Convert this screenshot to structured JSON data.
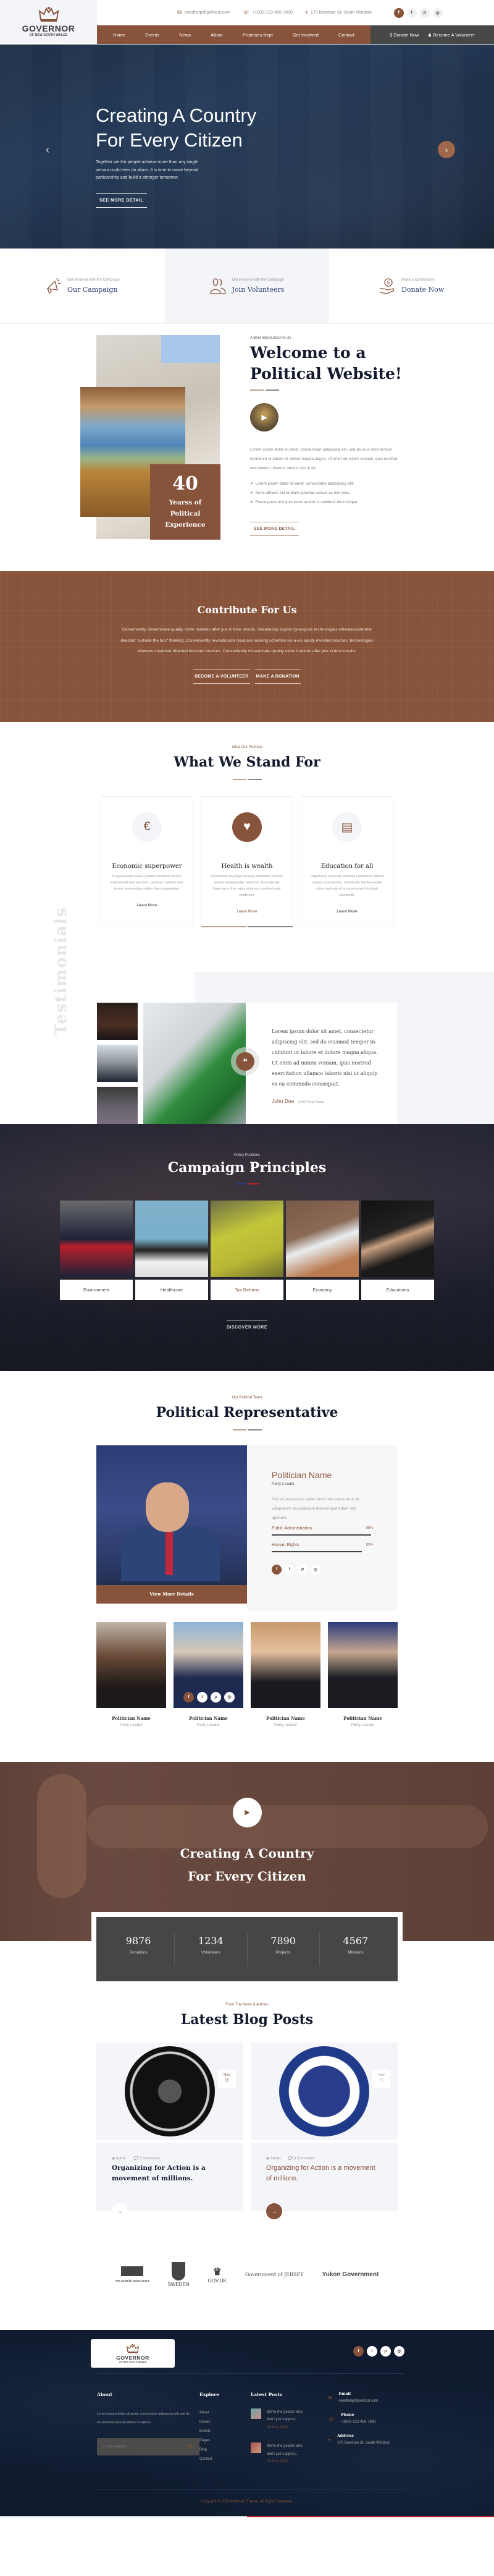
{
  "brand": {
    "title": "GOVERNOR",
    "subtitle": "OF NEW SOUTH WALES"
  },
  "topbar": {
    "email": "needhelp@political.com",
    "phone": "+1800-123-456-7890",
    "address": "170 Bowman St. South Windsor.",
    "socials": [
      "f",
      "t",
      "p",
      "i"
    ]
  },
  "nav": {
    "items": [
      "Home",
      "Events",
      "News",
      "About",
      "Promises Kept",
      "Get Involved",
      "Contact"
    ],
    "donate": "Donate Now",
    "volunteer": "Become A Volunteer"
  },
  "hero": {
    "title_line1": "Creating A Country",
    "title_line2": "For Every Citizen",
    "text": "Together we the people achieve more than any single person could ever do alone. It is time to move beyond partisanship and build a stronger tomorrow.",
    "button": "SEE MORE DETAIL"
  },
  "features": [
    {
      "small": "Get involved with the Campaign",
      "title": "Our Campaign",
      "icon": "megaphone-icon"
    },
    {
      "small": "Get involved with the Campaign",
      "title": "Join Volunteers",
      "icon": "people-icon"
    },
    {
      "small": "Make a Contribution",
      "title": "Donate Now",
      "icon": "donate-hand-icon"
    }
  ],
  "about": {
    "kicker": "A Brief Introduction to Us",
    "title_line1": "Welcome to a",
    "title_line2": "Political Website!",
    "text": "Lorem ipsum dolor sit amet, consectetur adipiscing elit, sed do eius-mod tempor incididunt ut labore et dolore magna aliqua. Ut enim ad minim veniam, quis nostrud exercitation ullamco laboris nisi ut ali-",
    "checks": [
      "Lorem ipsum dolor sit amet, consectetur adipisicing elit.",
      "Nunc ultrices est at diam pulvinar cursus ac non eros.",
      "Fusce porta orci quis lacus auctor, in eleifend dui tristique."
    ],
    "button": "SEE MORE DETAIL",
    "badge_number": "40",
    "badge_line1": "Yearss of",
    "badge_line2": "Political",
    "badge_line3": "Experience"
  },
  "contribute": {
    "title": "Contribute For Us",
    "text": "Conveniently disseminate quality niche markets after just in time results. Seamlessly exploit synergistic technologies whereascustomer directed \"outside the box\" thinking. Conveniently revolutionize resource sucking schemas vis-a-vis equity invested sources. technologies whereas customer directed  invested sources. Conveniently disseminate quality niche markets after just in time results.",
    "btn_volunteer": "BECOME A VOLUNTEER",
    "btn_donate": "MAKE A DONATION"
  },
  "stand": {
    "kicker": "What Our Promise",
    "title": "What We Stand For",
    "cards": [
      {
        "title": "Economic superpower",
        "text": "Progressively evolve parallel interfaces before empowered web services. Quick-ly cultivate one-to-one partnerships rather than cooperative.",
        "link": "Learn More",
        "icon": "€"
      },
      {
        "title": "Health is wealth",
        "text": "Seamlessly leverage existing worldwide sources before leading-edge networks. Dramatically foster error-free value whereas covalent web-readiness.",
        "link": "Learn More",
        "icon": "♥"
      },
      {
        "title": "Education for all",
        "text": "Objectively evacuate seamless platforms without unique communities. Holistically fashion world-class methods of empow-erment for high standards.",
        "link": "Learn More",
        "icon": "📚"
      }
    ]
  },
  "testimonials": {
    "vertical_label": "Testimonials",
    "quote": "Lorem ipsum dolor sit amet, consectetur adipiscing elit, sed do eiusmod tempor in-cididunt ut labore et dolore magna aliqua. Ut enim ad minim veniam, quis nostrud exercitation ullamco laboris nisi ut aliquip ex ea commodo consequat.",
    "name": "John Doe",
    "separator": "-",
    "role": "CEO Party Name"
  },
  "principles": {
    "kicker": "Policy Positions",
    "title": "Campaign Principles",
    "items": [
      "Environment",
      "Healthcare",
      "Tax Returns",
      "Economy",
      "Educations"
    ],
    "button": "DISCOVER MORE"
  },
  "representative": {
    "kicker": "Our Political Team",
    "title": "Political Representative",
    "featured": {
      "name": "Politician Name",
      "role": "Party Leader",
      "desc": "Sed ut perspiciatis unde omnis iste natus error sit voluptatem accusantium doloremque totam rem aperiam.",
      "view_more": "View More Details",
      "skills": [
        {
          "label": "Public Administration",
          "percent": 98,
          "display": "98%"
        },
        {
          "label": "Human Rights",
          "percent": 89,
          "display": "89%"
        }
      ]
    },
    "team": [
      {
        "name": "Politician Name",
        "role": "Party Leader"
      },
      {
        "name": "Politician Name",
        "role": "Party Leader"
      },
      {
        "name": "Politician Name",
        "role": "Party Leader"
      },
      {
        "name": "Politician Name",
        "role": "Party Leader"
      }
    ]
  },
  "band": {
    "title_line1": "Creating A Country",
    "title_line2": "For Every Citizen"
  },
  "stats": [
    {
      "number": "9876",
      "label": "Donations"
    },
    {
      "number": "1234",
      "label": "Volunteers"
    },
    {
      "number": "7890",
      "label": "Projects"
    },
    {
      "number": "4567",
      "label": "Missions"
    }
  ],
  "blog": {
    "kicker": "From The News & Articles",
    "title": "Latest Blog Posts",
    "posts": [
      {
        "month": "Nov",
        "day": "15",
        "author": "Admin",
        "comments": "3 Comments",
        "title": "Organizing for Action is a movement of millions.",
        "image_alt": "The State of Texas Governor seal"
      },
      {
        "month": "Nov",
        "day": "15",
        "author": "Admin",
        "comments": "3 Comments",
        "title": "Organizing for Action is a movement of millions.",
        "image_alt": "Lt. Governor State of Connecticut seal"
      }
    ]
  },
  "partners": [
    "The Scottish Government",
    "SWEDEN",
    "GOV.UK",
    "Government of JERSEY",
    "Yukon Government"
  ],
  "footer": {
    "about_title": "About",
    "about_text": "Lorem ipsum dolor sit amet, consectetur adipiscing elit sed do eiusmod tempor incididunt ut labore.",
    "email_placeholder": "Email Address",
    "explore_title": "Explore",
    "explore_links": [
      "About",
      "Issues",
      "Events",
      "Pages",
      "Blog",
      "Contact"
    ],
    "posts_title": "Latest Posts",
    "posts": [
      {
        "text_line1": "We're the people who",
        "text_line2": "don't just support...",
        "date": "18 Nov, 2019"
      },
      {
        "text_line1": "We're the people who",
        "text_line2": "don't just support...",
        "date": "18 Nov, 2019"
      }
    ],
    "contact": [
      {
        "label": "Email",
        "value": "needhelp@political.com"
      },
      {
        "label": "Phone",
        "value": "+1800-123-456-7890"
      },
      {
        "label": "Address",
        "value": "170 Bowman St. South Windsor."
      }
    ],
    "copyright": "Copyright © 2019 Politician Theme. All Rights Reserved."
  },
  "colors": {
    "accent": "#87533a",
    "dark": "#474747",
    "navy": "#0f1a2e",
    "light_bg": "#f4f5f9"
  }
}
